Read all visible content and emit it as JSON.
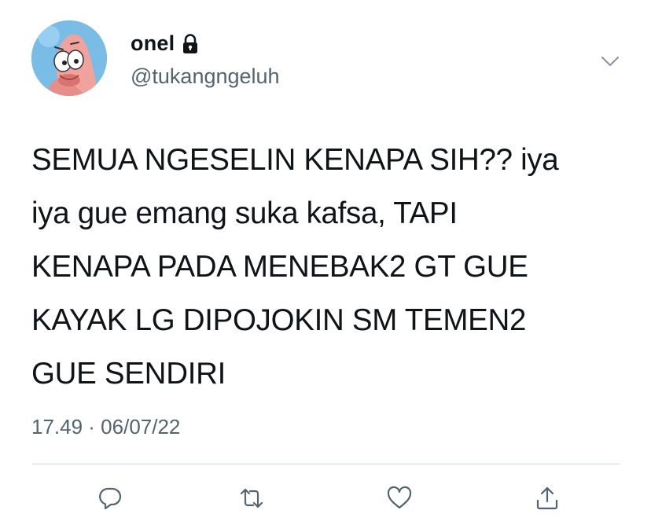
{
  "user": {
    "display_name": "onel",
    "handle": "@tukangngeluh",
    "protected_icon": "lock-icon",
    "avatar_icon": "patrick-star-avatar"
  },
  "tweet": {
    "text": "SEMUA NGESELIN KENAPA SIH?? iya\niya gue emang suka kafsa, TAPI\nKENAPA PADA MENEBAK2 GT GUE\nKAYAK LG DIPOJOKIN SM TEMEN2\nGUE SENDIRI",
    "timestamp": "17.49 · 06/07/22"
  },
  "actions": [
    {
      "name": "reply",
      "icon": "reply-icon"
    },
    {
      "name": "retweet",
      "icon": "retweet-icon"
    },
    {
      "name": "like",
      "icon": "heart-icon"
    },
    {
      "name": "share",
      "icon": "share-icon"
    }
  ],
  "menu_icon": "chevron-down-icon",
  "colors": {
    "text": "#0f1419",
    "secondary": "#536471",
    "divider": "#cfd9de",
    "avatar_bg": "#6fb6e2",
    "patrick_pink": "#f2a7a2"
  }
}
